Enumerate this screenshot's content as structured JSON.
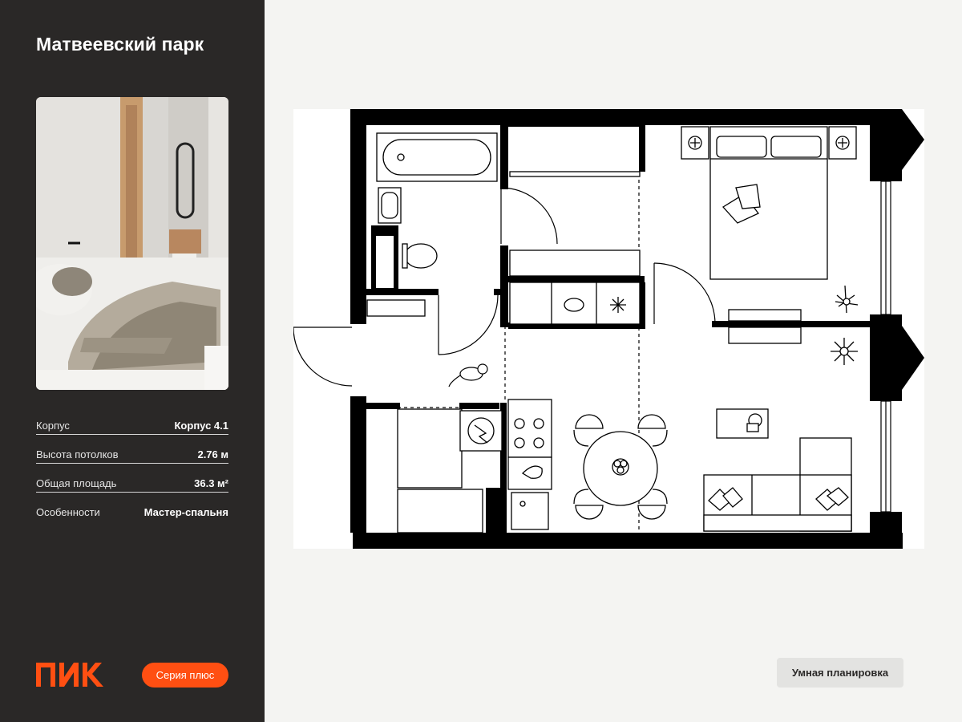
{
  "header": {
    "project_title": "Матвеевский парк"
  },
  "photo": {
    "description_icon": "bedroom-photo"
  },
  "specs": [
    {
      "label": "Корпус",
      "value": "Корпус 4.1"
    },
    {
      "label": "Высота потолков",
      "value": "2.76 м"
    },
    {
      "label": "Общая площадь",
      "value": "36.3 м²"
    },
    {
      "label": "Особенности",
      "value": "Мастер-спальня"
    }
  ],
  "footer": {
    "brand": "ПИК",
    "series_badge": "Серия плюс",
    "smart_layout_badge": "Умная планировка"
  },
  "colors": {
    "sidebar_bg": "#2a2827",
    "brand_orange": "#ff4f12",
    "page_bg": "#f4f4f2",
    "wall": "#000000"
  }
}
